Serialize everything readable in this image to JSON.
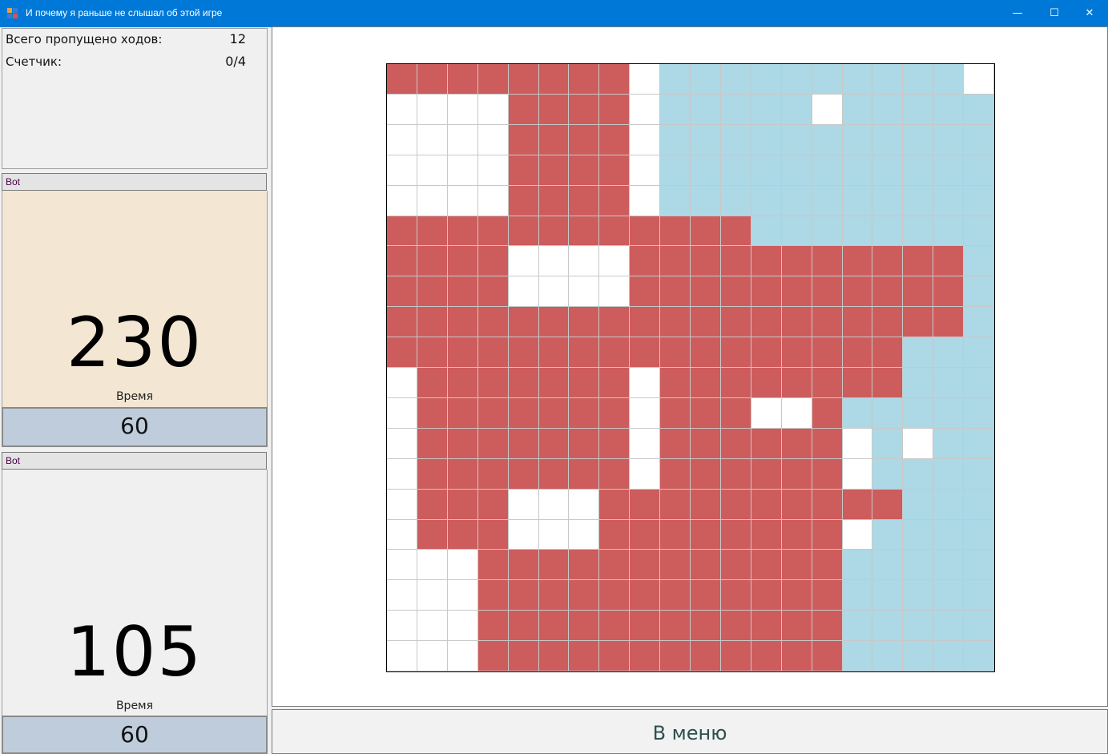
{
  "window": {
    "title": "И почему я раньше не слышал об этой игре",
    "minimize_glyph": "—",
    "maximize_glyph": "☐",
    "close_glyph": "✕"
  },
  "stats": {
    "skipped_label": "Всего пропущено ходов:",
    "skipped_value": "12",
    "counter_label": "Счетчик:",
    "counter_value": "0/4"
  },
  "players": [
    {
      "name": "Bot",
      "score": "230",
      "time_label": "Время",
      "time": "60",
      "highlight_color": "#f3e6d3"
    },
    {
      "name": "Bot",
      "score": "105",
      "time_label": "Время",
      "time": "60",
      "highlight_color": "#f0f0f0"
    }
  ],
  "board": {
    "size": 20,
    "legend": {
      "R": "#cd5c5c",
      "B": "#add8e6",
      "W": "#ffffff"
    },
    "rows": [
      "RRRRRRRRWBBBBBBBBBBW",
      "WWWWRRRRWBBBBBWBBBBB",
      "WWWWRRRRWBBBBBBBBBBB",
      "WWWWRRRRWBBBBBBBBBBB",
      "WWWWRRRRWBBBBBBBBBBB",
      "RRRRRRRRRRRRBBBBBBBB",
      "RRRRWWWWRRRRRRRRRRRB",
      "RRRRWWWWRRRRRRRRRRRB",
      "RRRRRRRRRRRRRRRRRRRB",
      "RRRRRRRRRRRRRRRRRBBB",
      "WRRRRRRRWRRRRRRRRBBB",
      "WRRRRRRRWRRRWWRBBBBB",
      "WRRRRRRRWRRRRRRWBWBB",
      "WRRRRRRRWRRRRRRWBBBB",
      "WRRRWWWRRRRRRRRRRBBB",
      "WRRRWWWRRRRRRRRWBBBB",
      "WWWRRRRRRRRRRRRBBBBB",
      "WWWRRRRRRRRRRRRBBBBB",
      "WWWRRRRRRRRRRRRBBBBB",
      "WWWRRRRRRRRRRRRBBBBB"
    ]
  },
  "menu_button_label": "В меню"
}
